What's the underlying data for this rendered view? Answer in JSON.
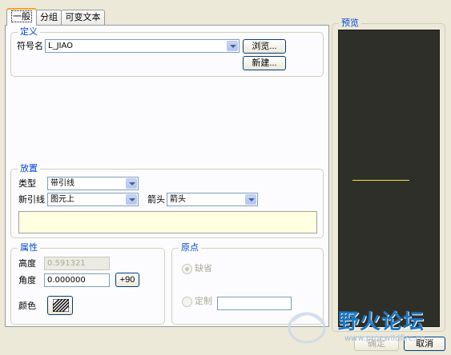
{
  "tabs": [
    {
      "label": "一般",
      "active": true
    },
    {
      "label": "分组",
      "active": false
    },
    {
      "label": "可变文本",
      "active": false
    }
  ],
  "definition": {
    "legend": "定义",
    "symbol_label": "符号名",
    "symbol_value": "L_JIAO",
    "browse_button": "浏览...",
    "new_button": "新建..."
  },
  "placement": {
    "legend": "放置",
    "type_label": "类型",
    "type_value": "带引线",
    "leader_label": "新引线",
    "leader_value": "图元上",
    "arrow_label": "箭头",
    "arrow_value": "箭头"
  },
  "attributes": {
    "legend": "属性",
    "height_label": "高度",
    "height_value": "0.591321",
    "angle_label": "角度",
    "angle_value": "0.000000",
    "plus90_button": "+90",
    "color_label": "颜色"
  },
  "origin": {
    "legend": "原点",
    "default_label": "缺省",
    "custom_label": "定制",
    "custom_value": ""
  },
  "preview": {
    "legend": "预览",
    "canvas_color": "#2f2f2a",
    "line_color": "#f5e23c"
  },
  "footer": {
    "ok_button": "确定",
    "cancel_button": "取消"
  },
  "watermark": {
    "text": "野火论坛",
    "url": "www.proewildfire.cn"
  },
  "colors": {
    "accent": "#0046d5",
    "tab_highlight": "#f1a42c",
    "window": "#ece9d8"
  }
}
